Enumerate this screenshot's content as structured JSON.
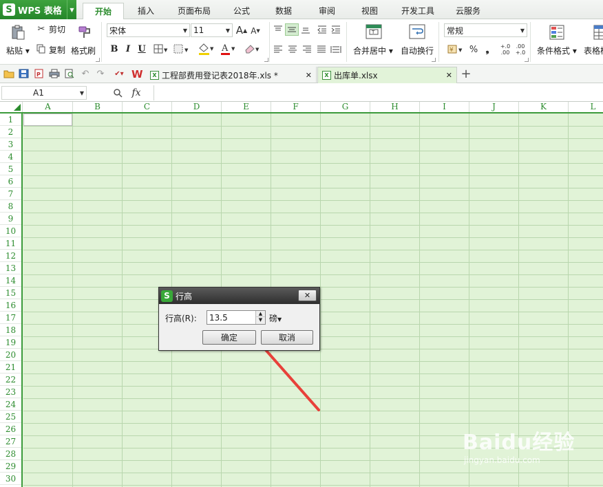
{
  "app": {
    "logo": "S",
    "name": "WPS 表格"
  },
  "ribbon_tabs": [
    "开始",
    "插入",
    "页面布局",
    "公式",
    "数据",
    "审阅",
    "视图",
    "开发工具",
    "云服务"
  ],
  "ribbon": {
    "paste": "粘贴",
    "cut": "剪切",
    "copy": "复制",
    "format_painter": "格式刷",
    "font_name": "宋体",
    "font_size": "11",
    "grow_font": "A",
    "shrink_font": "A",
    "bold": "B",
    "italic": "I",
    "underline": "U",
    "font_color_letter": "A",
    "merge_center": "合并居中",
    "wrap_text": "自动换行",
    "number_format": "常规",
    "percent": "%",
    "comma": "❟",
    "dec_increase": "+.0 .00",
    "dec_decrease": ".00 +.0",
    "conditional_format": "条件格式",
    "table_style": "表格样"
  },
  "documents": [
    {
      "name": "工程部费用登记表2018年.xls *",
      "active": false
    },
    {
      "name": "出库单.xlsx",
      "active": true
    }
  ],
  "new_tab": "+",
  "formula_bar": {
    "name_box": "A1",
    "fx": "fx",
    "formula": ""
  },
  "columns": [
    "A",
    "B",
    "C",
    "D",
    "E",
    "F",
    "G",
    "H",
    "I",
    "J",
    "K",
    "L"
  ],
  "rows": [
    "1",
    "2",
    "3",
    "4",
    "5",
    "6",
    "7",
    "8",
    "9",
    "10",
    "11",
    "12",
    "13",
    "14",
    "15",
    "16",
    "17",
    "18",
    "19",
    "20",
    "21",
    "22",
    "23",
    "24",
    "25",
    "26",
    "27",
    "28",
    "29",
    "30"
  ],
  "dialog": {
    "logo": "S",
    "title": "行高",
    "close": "✕",
    "label": "行高(R):",
    "value": "13.5",
    "unit": "磅",
    "ok": "确定",
    "cancel": "取消"
  },
  "watermark": {
    "brand": "Baidu经验",
    "url": "jingyan.baidu.com"
  },
  "colors": {
    "accent": "#2c8c2e",
    "grid_bg": "#e1f3d7",
    "arrow": "#e8413a"
  }
}
